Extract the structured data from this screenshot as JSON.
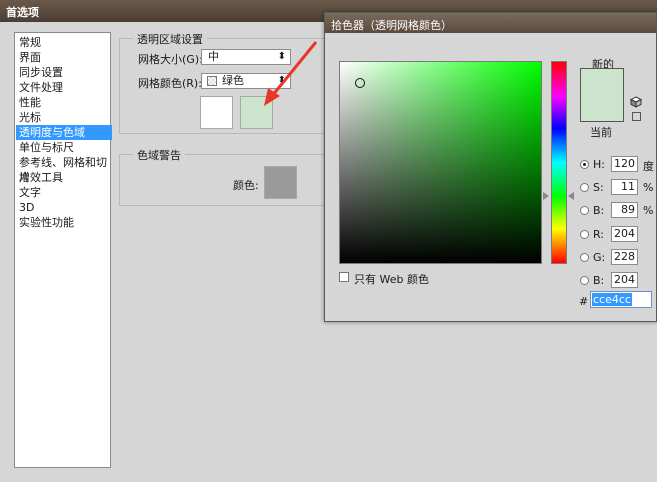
{
  "window": {
    "title": "首选项"
  },
  "sidebar": {
    "items": [
      {
        "label": "常规"
      },
      {
        "label": "界面"
      },
      {
        "label": "同步设置"
      },
      {
        "label": "文件处理"
      },
      {
        "label": "性能"
      },
      {
        "label": "光标"
      },
      {
        "label": "透明度与色域"
      },
      {
        "label": "单位与标尺"
      },
      {
        "label": "参考线、网格和切片"
      },
      {
        "label": "增效工具"
      },
      {
        "label": "文字"
      },
      {
        "label": "3D"
      },
      {
        "label": "实验性功能"
      }
    ],
    "selected_index": 6
  },
  "transparency": {
    "group_title": "透明区域设置",
    "grid_size_label": "网格大小(G):",
    "grid_size_value": "中",
    "grid_color_label": "网格颜色(R):",
    "grid_color_value": "绿色",
    "swatch_light": "#ffffff",
    "swatch_dark": "#cce4cc"
  },
  "gamut": {
    "group_title": "色域警告",
    "color_label": "颜色:",
    "color_value": "#9a9a9a"
  },
  "picker": {
    "title": "拾色器（透明网格颜色）",
    "new_label": "新的",
    "current_label": "当前",
    "new_color": "#cce4cc",
    "current_color": "#cce4cc",
    "web_only_label": "只有 Web 颜色",
    "hsb": [
      {
        "label": "H:",
        "value": "120",
        "unit": "度",
        "selected": true
      },
      {
        "label": "S:",
        "value": "11",
        "unit": "%",
        "selected": false
      },
      {
        "label": "B:",
        "value": "89",
        "unit": "%",
        "selected": false
      }
    ],
    "rgb": [
      {
        "label": "R:",
        "value": "204"
      },
      {
        "label": "G:",
        "value": "228"
      },
      {
        "label": "B:",
        "value": "204"
      }
    ],
    "hex_label": "#",
    "hex_value": "cce4cc",
    "hue_color": "#00ff00",
    "annotation_color": "#e8372a"
  }
}
